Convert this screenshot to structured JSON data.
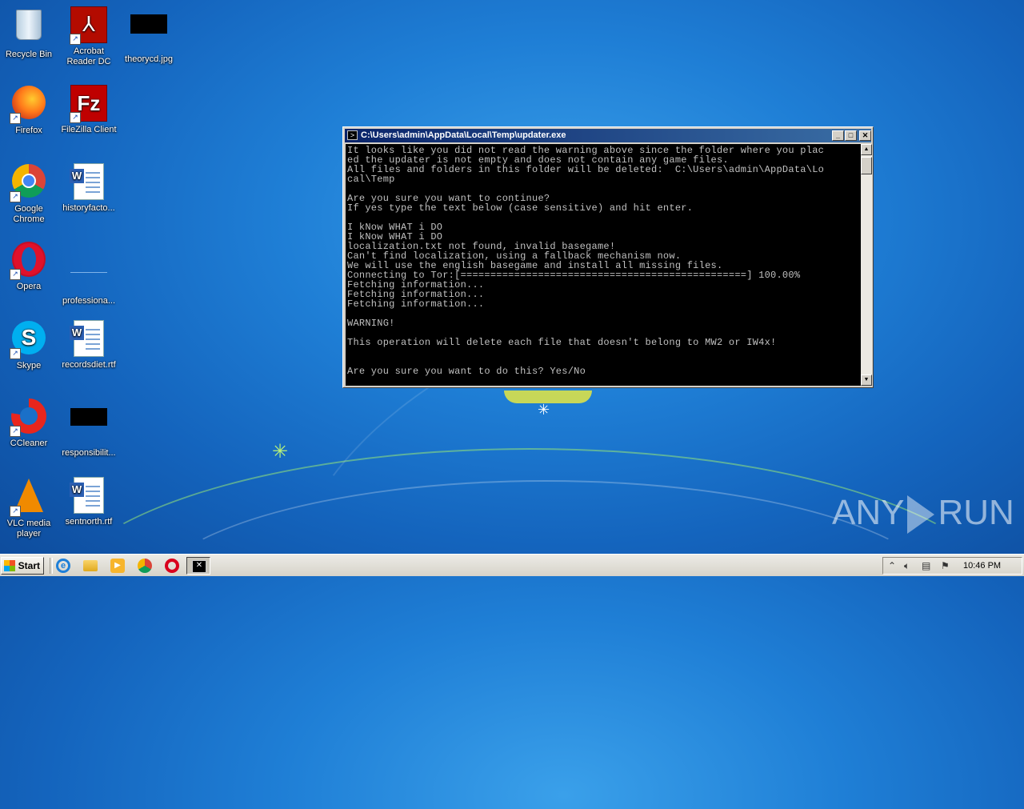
{
  "desktop": {
    "icons": [
      {
        "label": "Recycle Bin"
      },
      {
        "label": "Acrobat Reader DC"
      },
      {
        "label": "theorycd.jpg"
      },
      {
        "label": "Firefox"
      },
      {
        "label": "FileZilla Client"
      },
      {
        "label": "Google Chrome"
      },
      {
        "label": "historyfacto..."
      },
      {
        "label": "Opera"
      },
      {
        "label": "professiona..."
      },
      {
        "label": "Skype"
      },
      {
        "label": "recordsdiet.rtf"
      },
      {
        "label": "CCleaner"
      },
      {
        "label": "responsibilit..."
      },
      {
        "label": "VLC media player"
      },
      {
        "label": "sentnorth.rtf"
      }
    ]
  },
  "cmd_window": {
    "title": "C:\\Users\\admin\\AppData\\Local\\Temp\\updater.exe",
    "console_text": "It looks like you did not read the warning above since the folder where you plac\ned the updater is not empty and does not contain any game files.\nAll files and folders in this folder will be deleted:  C:\\Users\\admin\\AppData\\Lo\ncal\\Temp\n\nAre you sure you want to continue?\nIf yes type the text below (case sensitive) and hit enter.\n\nI kNow WHAT i DO\nI kNow WHAT i DO\nlocalization.txt not found, invalid basegame!\nCan't find localization, using a fallback mechanism now.\nWe will use the english basegame and install all missing files.\nConnecting to Tor:[================================================] 100.00%\nFetching information...\nFetching information...\nFetching information...\n\nWARNING!\n\nThis operation will delete each file that doesn't belong to MW2 or IW4x!\n\n\nAre you sure you want to do this? Yes/No",
    "buttons": {
      "minimize": "_",
      "maximize": "□",
      "close": "✕"
    },
    "scroll_up": "▲",
    "scroll_down": "▼"
  },
  "watermark": {
    "left": "ANY",
    "right": "RUN"
  },
  "taskbar": {
    "start_label": "Start",
    "clock": "10:46 PM"
  }
}
